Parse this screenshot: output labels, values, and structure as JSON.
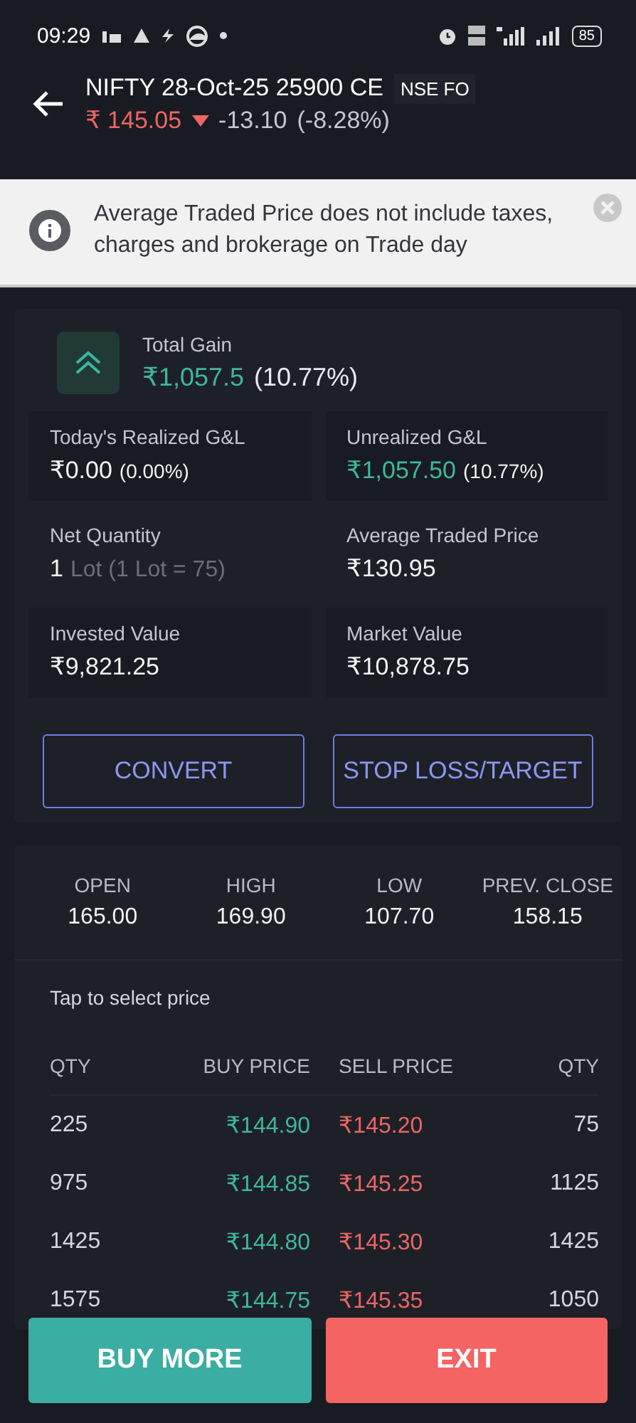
{
  "status_bar": {
    "time": "09:29",
    "battery": "85"
  },
  "header": {
    "title": "NIFTY 28-Oct-25 25900 CE",
    "exchange": "NSE FO",
    "price": "₹ 145.05",
    "falling": true,
    "change": "-13.10",
    "change_pct": "(-8.28%)"
  },
  "notice": {
    "text": "Average Traded Price does not include taxes, charges and brokerage on Trade day"
  },
  "total_gain": {
    "label": "Total Gain",
    "value": "₹1,057.5",
    "pct": "(10.77%)",
    "rising": true
  },
  "stats": [
    {
      "kind": "tile",
      "label": "Today's Realized G&L",
      "value": "₹0.00",
      "gain": false,
      "note": "(0.00%)",
      "note_muted": false
    },
    {
      "kind": "tile",
      "label": "Unrealized G&L",
      "value": "₹1,057.50",
      "gain": true,
      "note": "(10.77%)",
      "note_muted": false
    },
    {
      "kind": "plain",
      "label": "Net Quantity",
      "value": "1",
      "gain": false,
      "note": "Lot (1 Lot = 75)",
      "note_muted": true
    },
    {
      "kind": "plain",
      "label": "Average Traded Price",
      "value": "₹130.95",
      "gain": false
    },
    {
      "kind": "tile",
      "label": "Invested Value",
      "value": "₹9,821.25",
      "gain": false
    },
    {
      "kind": "tile",
      "label": "Market Value",
      "value": "₹10,878.75",
      "gain": false
    }
  ],
  "actions": [
    "CONVERT",
    "STOP LOSS/TARGET"
  ],
  "ohlc": [
    {
      "label": "OPEN",
      "value": "165.00"
    },
    {
      "label": "HIGH",
      "value": "169.90"
    },
    {
      "label": "LOW",
      "value": "107.70"
    },
    {
      "label": "PREV. CLOSE",
      "value": "158.15"
    }
  ],
  "depth": {
    "hint": "Tap to select price",
    "columns": [
      "QTY",
      "BUY PRICE",
      "SELL PRICE",
      "QTY"
    ],
    "rows": [
      {
        "bid_qty": "225",
        "bid": "₹144.90",
        "ask": "₹145.20",
        "ask_qty": "75"
      },
      {
        "bid_qty": "975",
        "bid": "₹144.85",
        "ask": "₹145.25",
        "ask_qty": "1125"
      },
      {
        "bid_qty": "1425",
        "bid": "₹144.80",
        "ask": "₹145.30",
        "ask_qty": "1425"
      },
      {
        "bid_qty": "1575",
        "bid": "₹144.75",
        "ask": "₹145.35",
        "ask_qty": "1050"
      }
    ]
  },
  "bottom_buttons": [
    {
      "label": "BUY MORE",
      "kind": "buy"
    },
    {
      "label": "EXIT",
      "kind": "exit"
    }
  ]
}
